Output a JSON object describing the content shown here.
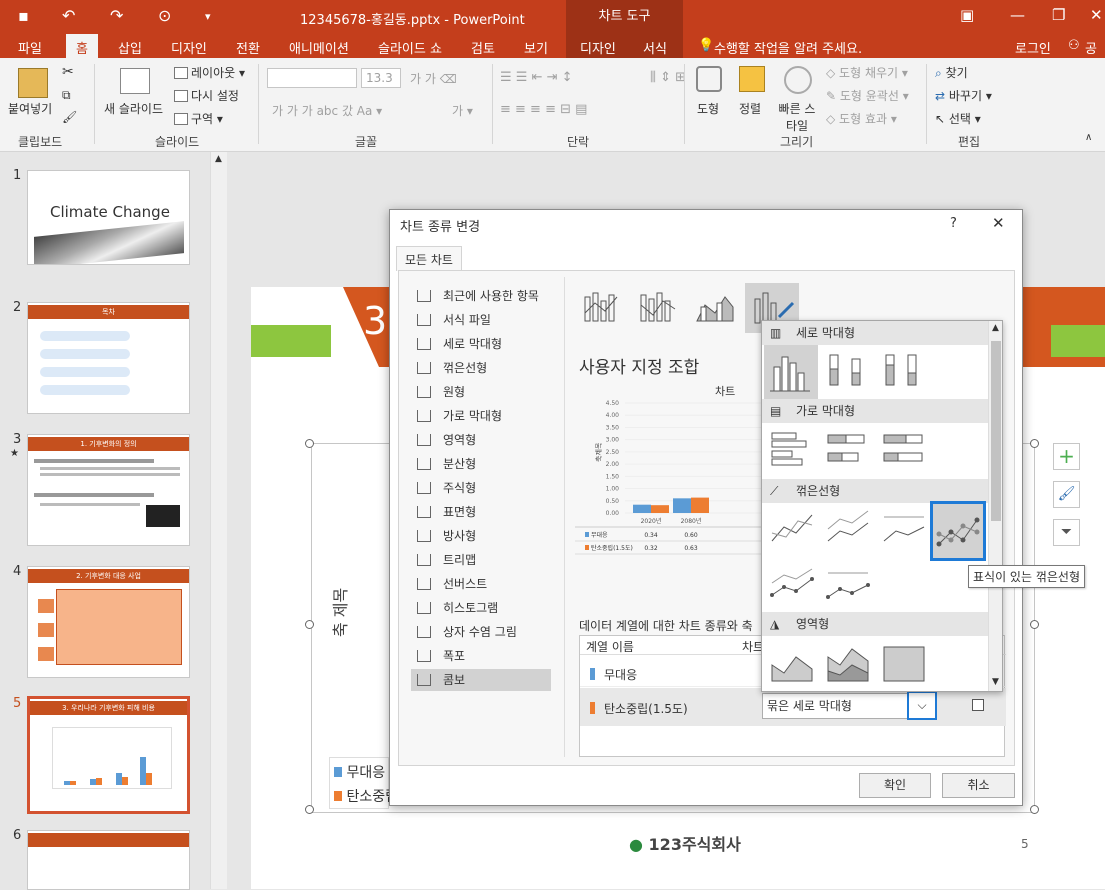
{
  "titlebar": {
    "doc_title": "12345678-홍길동.pptx - PowerPoint",
    "tools_title": "차트 도구"
  },
  "tabs": [
    "파일",
    "홈",
    "삽입",
    "디자인",
    "전환",
    "애니메이션",
    "슬라이드 쇼",
    "검토",
    "보기",
    "디자인",
    "서식"
  ],
  "tell_me": "수행할 작업을 알려 주세요.",
  "login": "로그인",
  "share": "공유",
  "ribbon": {
    "clipboard": {
      "paste": "붙여넣기",
      "label": "클립보드"
    },
    "slides": {
      "new_slide": "새 슬라이드",
      "layout": "레이아웃",
      "reset": "다시 설정",
      "section": "구역",
      "label": "슬라이드"
    },
    "font": {
      "font_size": "13.3",
      "label": "글꼴"
    },
    "paragraph": {
      "label": "단락"
    },
    "drawing": {
      "shape": "도형",
      "arrange": "정렬",
      "quick_style": "빠른 스타일",
      "fill": "도형 채우기",
      "outline": "도형 윤곽선",
      "effect": "도형 효과",
      "label": "그리기"
    },
    "editing": {
      "find": "찾기",
      "replace": "바꾸기",
      "select": "선택",
      "label": "편집"
    }
  },
  "thumbs": {
    "t1_title": "Climate Change",
    "t2_title": "목차",
    "t3_title": "1. 기후변화의 정의",
    "t4_title": "2. 기후변화 대응 사업",
    "t5_title": "3. 우리나라 기후변화 피해 비용",
    "numbers": [
      "1",
      "2",
      "3",
      "4",
      "5",
      "6"
    ]
  },
  "slide": {
    "y_axis": "축 제목",
    "legend_1": "무대응",
    "legend_2": "탄소중립",
    "page_number": "5",
    "logo_text": "123주식회사",
    "title_num": "3"
  },
  "dialog": {
    "title": "차트 종류 변경",
    "help": "?",
    "close": "✕",
    "tab": "모든 차트",
    "categories": [
      "최근에 사용한 항목",
      "서식 파일",
      "세로 막대형",
      "꺾은선형",
      "원형",
      "가로 막대형",
      "영역형",
      "분산형",
      "주식형",
      "표면형",
      "방사형",
      "트리맵",
      "선버스트",
      "히스토그램",
      "상자 수염 그림",
      "폭포",
      "콤보"
    ],
    "selected_category": "콤보",
    "combo_title": "사용자 지정 조합",
    "preview_title": "차트",
    "preview_ylabel": "축제목",
    "series_section": "데이터 계열에 대한 차트 종류와 축",
    "col_series": "계열 이름",
    "col_type": "차트",
    "row1_name": "무대응",
    "row2_name": "탄소중립(1.5도)",
    "row2_type": "묶은 세로 막대형",
    "ok": "확인",
    "cancel": "취소"
  },
  "chart_data": {
    "type": "bar",
    "categories": [
      "2020년",
      "2080년"
    ],
    "series": [
      {
        "name": "무대응",
        "values": [
          0.34,
          0.6
        ]
      },
      {
        "name": "탄소중립(1.5도)",
        "values": [
          0.32,
          0.63
        ]
      }
    ],
    "ylabel": "축제목",
    "ylim": [
      0,
      4.5
    ],
    "yticks": [
      "4.50",
      "4.00",
      "3.50",
      "3.00",
      "2.50",
      "2.00",
      "1.50",
      "1.00",
      "0.50",
      "0.00"
    ],
    "colors": [
      "#5b9bd5",
      "#ed7d31"
    ]
  },
  "dropdown": {
    "col_header": "세로 막대형",
    "bar_header": "가로 막대형",
    "line_header": "꺾은선형",
    "area_header": "영역형",
    "tooltip": "표식이 있는 꺾은선형"
  },
  "colors": {
    "accent": "#c43e1c",
    "select_blue": "#1e7ad6",
    "green": "#8dc63f",
    "orange": "#c5501e"
  }
}
